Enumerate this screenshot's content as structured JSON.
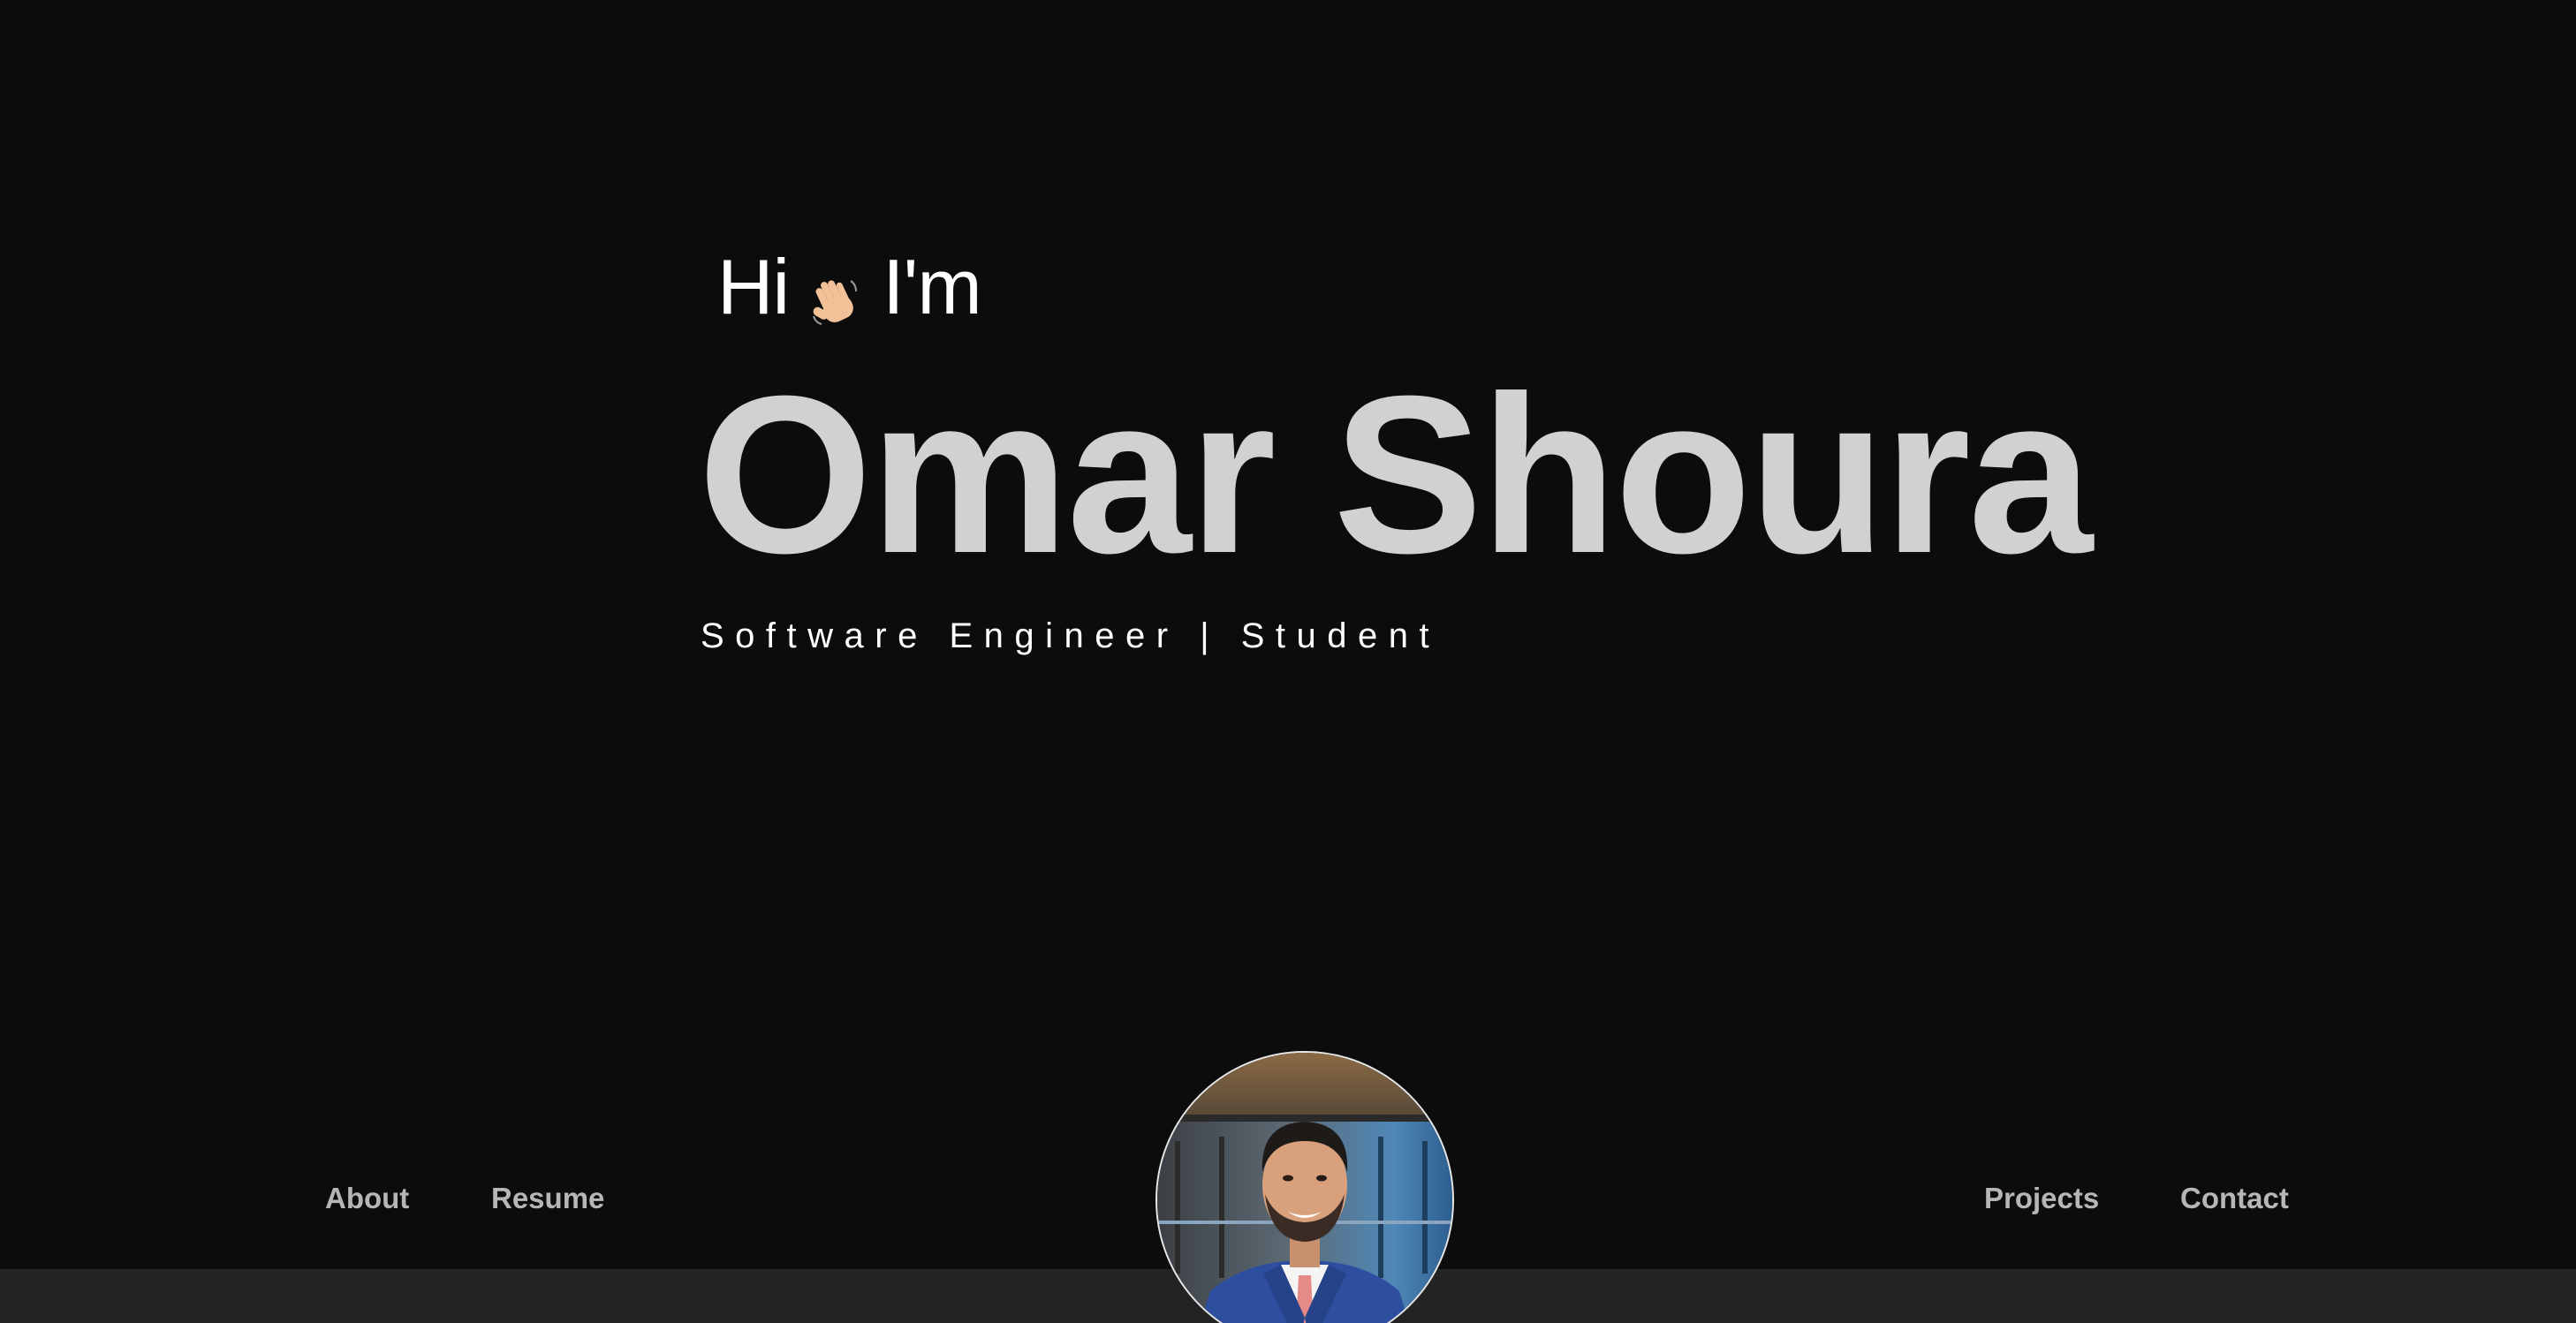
{
  "hero": {
    "greeting_prefix": "Hi",
    "greeting_icon": "waving-hand-icon",
    "greeting_suffix": "I'm",
    "name": "Omar Shoura",
    "subtitle": "Software Engineer | Student"
  },
  "nav": {
    "left": [
      {
        "label": "About"
      },
      {
        "label": "Resume"
      }
    ],
    "right": [
      {
        "label": "Projects"
      },
      {
        "label": "Contact"
      }
    ]
  },
  "avatar": {
    "icon": "profile-photo"
  },
  "colors": {
    "background": "#0c0c0c",
    "name_text": "#d1d1d1",
    "nav_text": "#b6b6b6",
    "bottom_bar": "#232323"
  }
}
